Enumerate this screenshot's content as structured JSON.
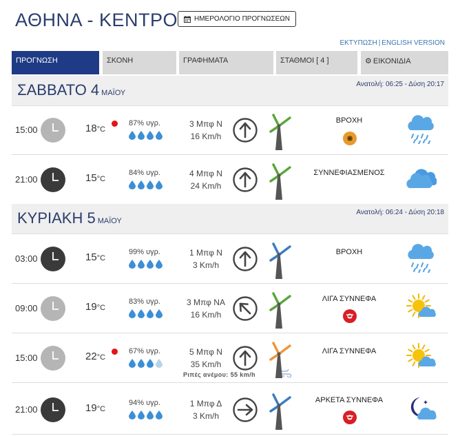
{
  "header": {
    "city": "ΑΘΗΝΑ - ΚΕΝΤΡΟ",
    "calendar_button": "ΗΜΕΡΟΛΟΓΙΟ ΠΡΟΓΝΩΣΕΩΝ",
    "print_link": "ΕΚΤΥΠΩΣΗ",
    "english_link": "ENGLISH VERSION"
  },
  "tabs": [
    "ΠΡΟΓΝΩΣΗ",
    "ΣΚΟΝΗ",
    "ΓΡΑΦΗΜΑΤΑ",
    "ΣΤΑΘΜΟΙ  [ 4 ]",
    "ΕΙΚΟΝΙΔΙΑ"
  ],
  "days": [
    {
      "title": "ΣΑΒΒΑΤΟ 4",
      "month": "ΜΑΪΟΥ",
      "sun_times": "Ανατολή: 06:25 - Δύση 20:17",
      "rows": [
        {
          "time": "15:00",
          "clock": "day",
          "temp": "18",
          "unit": "°C",
          "hot": true,
          "humidity": "87% υγρ.",
          "drops_full": 4,
          "wind_bf": "3 Μπφ Ν",
          "wind_kmh": "16 Km/h",
          "arrow": "up",
          "turbine": "green",
          "weather": "ΒΡΟΧΗ",
          "warning": "orange",
          "icon": "rain-icon"
        },
        {
          "time": "21:00",
          "clock": "night",
          "temp": "15",
          "unit": "°C",
          "hot": false,
          "humidity": "84% υγρ.",
          "drops_full": 4,
          "wind_bf": "4 Μπφ Ν",
          "wind_kmh": "24 Km/h",
          "arrow": "up",
          "turbine": "green",
          "weather": "ΣΥΝΝΕΦΙΑΣΜΕΝΟΣ",
          "warning": "",
          "icon": "clouds-icon"
        }
      ]
    },
    {
      "title": "ΚΥΡΙΑΚΗ 5",
      "month": "ΜΑΪΟΥ",
      "sun_times": "Ανατολή: 06:24 - Δύση 20:18",
      "rows": [
        {
          "time": "03:00",
          "clock": "night",
          "temp": "15",
          "unit": "°C",
          "hot": false,
          "humidity": "99% υγρ.",
          "drops_full": 4,
          "wind_bf": "1 Μπφ Ν",
          "wind_kmh": "3 Km/h",
          "arrow": "up",
          "turbine": "blue",
          "weather": "ΒΡΟΧΗ",
          "warning": "",
          "icon": "rain-icon"
        },
        {
          "time": "09:00",
          "clock": "day",
          "temp": "19",
          "unit": "°C",
          "hot": false,
          "humidity": "83% υγρ.",
          "drops_full": 4,
          "wind_bf": "3 Μπφ ΝΑ",
          "wind_kmh": "16 Km/h",
          "arrow": "up-left",
          "turbine": "green",
          "weather": "ΛΙΓΑ ΣΥΝΝΕΦΑ",
          "warning": "red",
          "icon": "sun-cloud-icon"
        },
        {
          "time": "15:00",
          "clock": "day",
          "temp": "22",
          "unit": "°C",
          "hot": true,
          "humidity": "67% υγρ.",
          "drops_full": 3,
          "wind_bf": "5 Μπφ Ν",
          "wind_kmh": "35 Km/h",
          "arrow": "up",
          "turbine": "orange",
          "weather": "ΛΙΓΑ ΣΥΝΝΕΦΑ",
          "warning": "",
          "icon": "sun-cloud-icon",
          "gust": "Ριπές ανέμου: 55 km/h"
        },
        {
          "time": "21:00",
          "clock": "night",
          "temp": "19",
          "unit": "°C",
          "hot": false,
          "humidity": "94% υγρ.",
          "drops_full": 4,
          "wind_bf": "1 Μπφ Δ",
          "wind_kmh": "3 Km/h",
          "arrow": "right",
          "turbine": "blue",
          "weather": "ΑΡΚΕΤΑ ΣΥΝΝΕΦΑ",
          "warning": "red",
          "icon": "moon-cloud-icon"
        }
      ]
    }
  ],
  "colors": {
    "brand": "#1f3b85",
    "title": "#2b3d6d",
    "link": "#3a73b0",
    "drop": "#3c8fd6",
    "hot_dot": "#e5131a"
  }
}
